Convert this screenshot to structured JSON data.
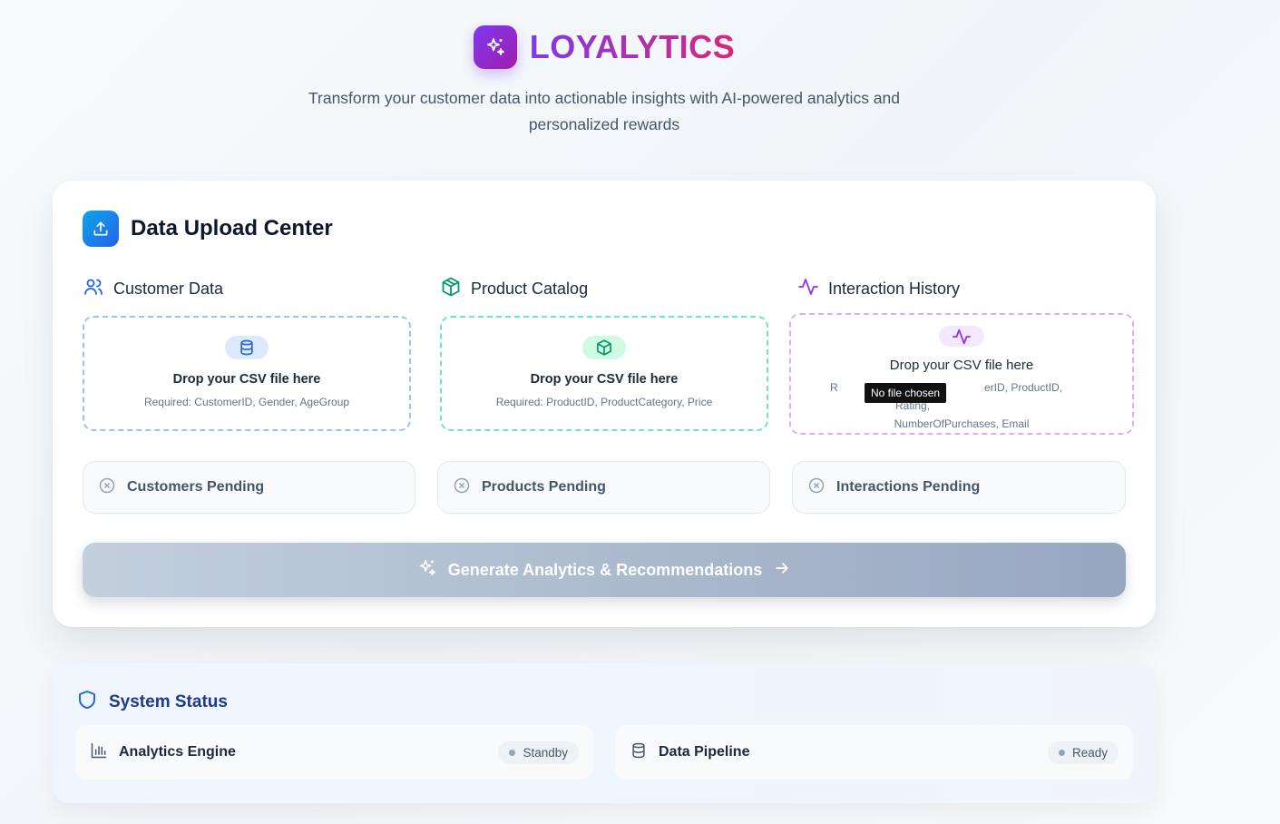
{
  "brand": {
    "name": "LOYALYTICS",
    "tagline": "Transform your customer data into actionable insights with AI-powered analytics and personalized rewards"
  },
  "upload": {
    "title": "Data Upload Center",
    "columns": [
      {
        "label": "Customer Data",
        "drop_text": "Drop your CSV file here",
        "required": "Required: CustomerID, Gender, AgeGroup",
        "color": "#2563eb"
      },
      {
        "label": "Product Catalog",
        "drop_text": "Drop your CSV file here",
        "required": "Required: ProductID, ProductCategory, Price",
        "color": "#059669"
      },
      {
        "label": "Interaction History",
        "drop_text": "Drop your CSV file here",
        "required_line1_start": "R",
        "required_line1_end": "erID, ProductID, Rating,",
        "required_line2": "NumberOfPurchases, Email",
        "color": "#9333ea"
      }
    ],
    "file_tooltip": "No file chosen",
    "statuses": [
      "Customers Pending",
      "Products Pending",
      "Interactions Pending"
    ],
    "generate_label": "Generate Analytics & Recommendations"
  },
  "system": {
    "title": "System Status",
    "items": [
      {
        "label": "Analytics Engine",
        "status": "Standby"
      },
      {
        "label": "Data Pipeline",
        "status": "Ready"
      }
    ]
  }
}
